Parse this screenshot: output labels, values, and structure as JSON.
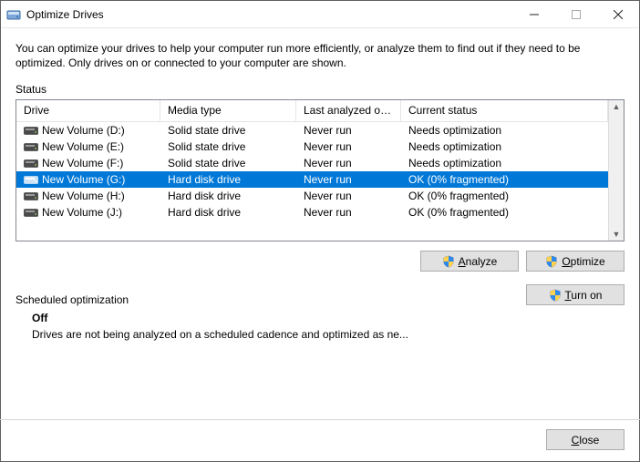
{
  "window": {
    "title": "Optimize Drives"
  },
  "description": "You can optimize your drives to help your computer run more efficiently, or analyze them to find out if they need to be optimized. Only drives on or connected to your computer are shown.",
  "status_label": "Status",
  "columns": {
    "drive": "Drive",
    "media": "Media type",
    "last": "Last analyzed or o...",
    "status": "Current status"
  },
  "rows": [
    {
      "drive": "New Volume (D:)",
      "media": "Solid state drive",
      "last": "Never run",
      "status": "Needs optimization",
      "selected": false
    },
    {
      "drive": "New Volume (E:)",
      "media": "Solid state drive",
      "last": "Never run",
      "status": "Needs optimization",
      "selected": false
    },
    {
      "drive": "New Volume (F:)",
      "media": "Solid state drive",
      "last": "Never run",
      "status": "Needs optimization",
      "selected": false
    },
    {
      "drive": "New Volume (G:)",
      "media": "Hard disk drive",
      "last": "Never run",
      "status": "OK (0% fragmented)",
      "selected": true
    },
    {
      "drive": "New Volume (H:)",
      "media": "Hard disk drive",
      "last": "Never run",
      "status": "OK (0% fragmented)",
      "selected": false
    },
    {
      "drive": "New Volume (J:)",
      "media": "Hard disk drive",
      "last": "Never run",
      "status": "OK (0% fragmented)",
      "selected": false
    }
  ],
  "buttons": {
    "analyze_pre": "",
    "analyze_u": "A",
    "analyze_post": "nalyze",
    "optimize_pre": "",
    "optimize_u": "O",
    "optimize_post": "ptimize",
    "turnon_pre": "",
    "turnon_u": "T",
    "turnon_post": "urn on",
    "close_pre": "",
    "close_u": "C",
    "close_post": "lose"
  },
  "scheduled": {
    "label": "Scheduled optimization",
    "state": "Off",
    "desc": "Drives are not being analyzed on a scheduled cadence and optimized as ne..."
  }
}
